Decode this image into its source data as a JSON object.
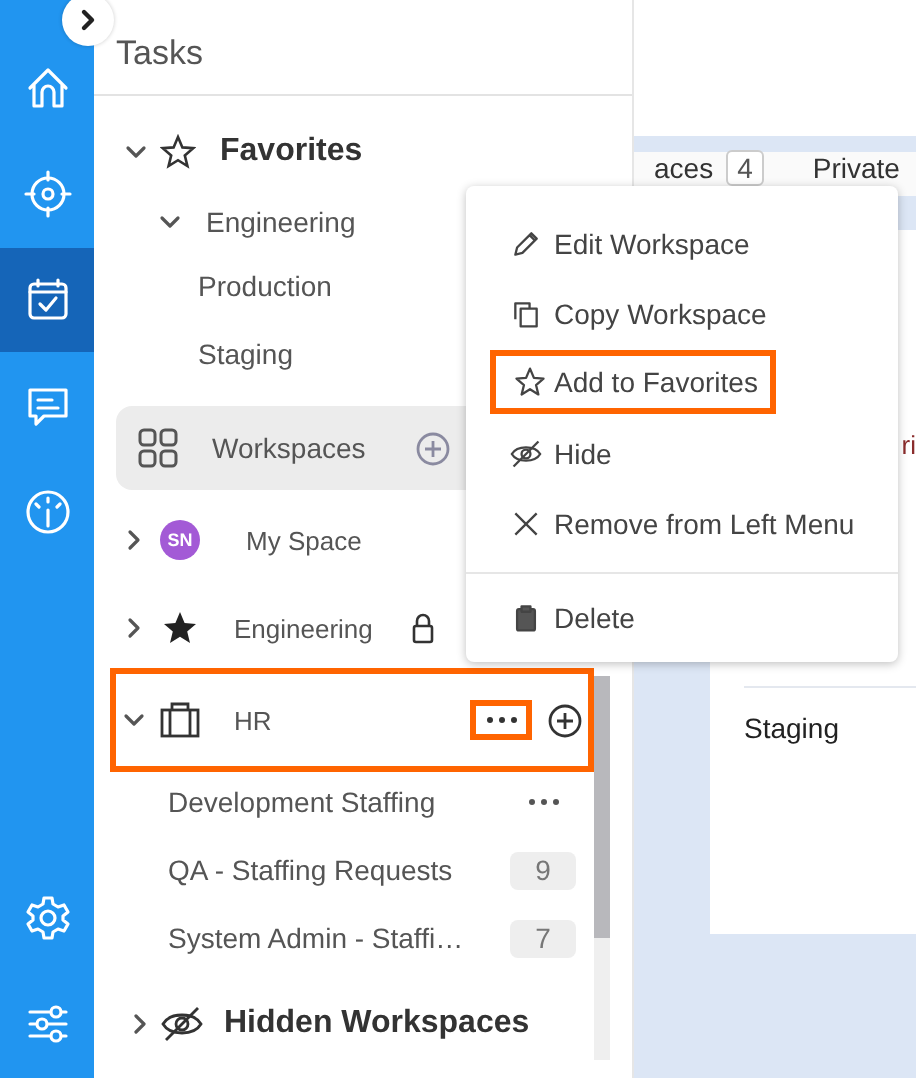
{
  "rail": {
    "items": [
      {
        "kind": "home",
        "selected": false
      },
      {
        "kind": "target",
        "selected": false
      },
      {
        "kind": "tasks",
        "selected": true
      },
      {
        "kind": "chat",
        "selected": false
      },
      {
        "kind": "gauge",
        "selected": false
      }
    ],
    "bottom": [
      {
        "kind": "settings"
      },
      {
        "kind": "sliders"
      }
    ]
  },
  "panel": {
    "title": "Tasks",
    "favorites": {
      "label": "Favorites",
      "expanded": true,
      "children": [
        {
          "label": "Engineering",
          "expanded": true,
          "children": [
            {
              "label": "Production"
            },
            {
              "label": "Staging"
            }
          ]
        }
      ]
    },
    "workspaces": {
      "label": "Workspaces"
    },
    "items": [
      {
        "kind": "avatar",
        "initials": "SN",
        "label": "My Space",
        "expanded": false,
        "locked": false,
        "highlighted": false
      },
      {
        "kind": "starred",
        "label": "Engineering",
        "expanded": false,
        "locked": true,
        "highlighted": false
      },
      {
        "kind": "briefcase",
        "label": "HR",
        "expanded": true,
        "locked": false,
        "highlighted": true,
        "children": [
          {
            "label": "Development Staffing",
            "menu": true
          },
          {
            "label": "QA - Staffing Requests",
            "count": "9"
          },
          {
            "label": "System Admin - Staffi…",
            "count": "7"
          }
        ]
      }
    ],
    "hidden": {
      "label": "Hidden Workspaces",
      "expanded": false
    }
  },
  "menu": {
    "items": [
      {
        "kind": "edit",
        "label": "Edit Workspace",
        "highlighted": false
      },
      {
        "kind": "copy",
        "label": "Copy Workspace",
        "highlighted": false
      },
      {
        "kind": "star",
        "label": "Add to Favorites",
        "highlighted": true
      },
      {
        "kind": "hide",
        "label": "Hide",
        "highlighted": false
      },
      {
        "kind": "remove",
        "label": "Remove from Left Menu",
        "highlighted": false
      },
      {
        "kind": "delete",
        "label": "Delete",
        "highlighted": false
      }
    ]
  },
  "main": {
    "tab": "aces",
    "count": "4",
    "tab_2": "Private",
    "cell": "ri",
    "row": "Staging"
  }
}
